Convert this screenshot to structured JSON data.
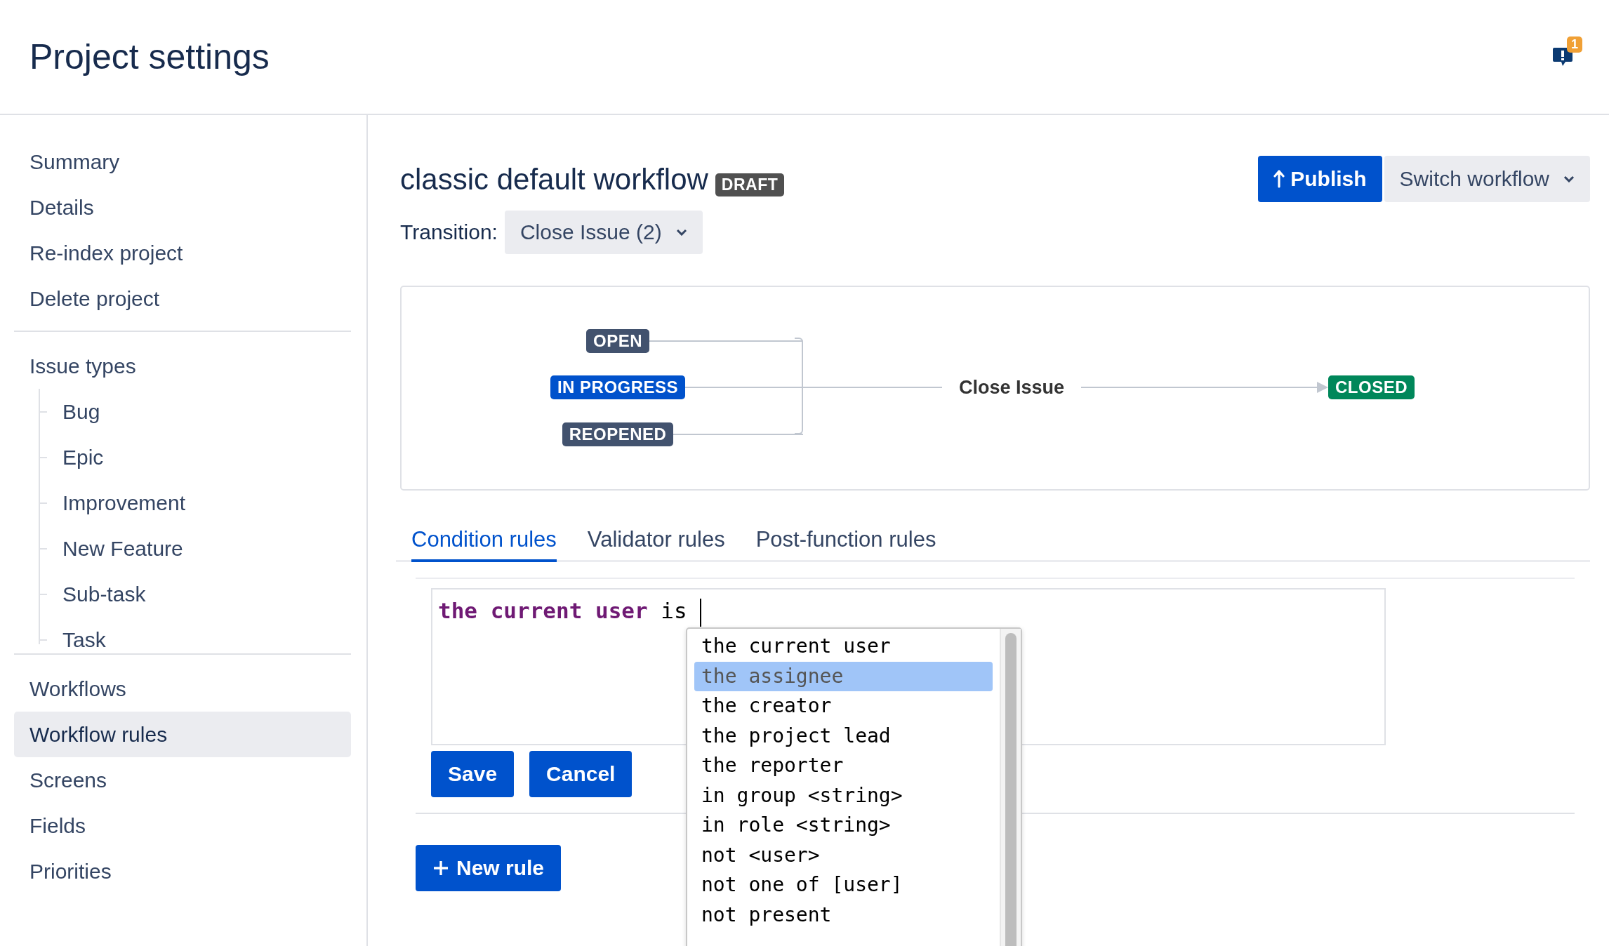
{
  "header": {
    "title": "Project settings",
    "notification_count": "1"
  },
  "sidebar": {
    "groups": [
      {
        "items": [
          {
            "label": "Summary",
            "selected": false
          },
          {
            "label": "Details",
            "selected": false
          },
          {
            "label": "Re-index project",
            "selected": false
          },
          {
            "label": "Delete project",
            "selected": false
          }
        ]
      },
      {
        "items": [
          {
            "label": "Issue types",
            "selected": false,
            "children": [
              {
                "label": "Bug",
                "selected": false
              },
              {
                "label": "Epic",
                "selected": false
              },
              {
                "label": "Improvement",
                "selected": false
              },
              {
                "label": "New Feature",
                "selected": false
              },
              {
                "label": "Sub-task",
                "selected": false
              },
              {
                "label": "Task",
                "selected": false
              }
            ]
          }
        ]
      },
      {
        "items": [
          {
            "label": "Workflows",
            "selected": false
          },
          {
            "label": "Workflow rules",
            "selected": true
          },
          {
            "label": "Screens",
            "selected": false
          },
          {
            "label": "Fields",
            "selected": false
          },
          {
            "label": "Priorities",
            "selected": false
          }
        ]
      }
    ]
  },
  "workflow": {
    "title": "classic default workflow",
    "status_badge": "DRAFT",
    "publish_button": "Publish",
    "switch_button": "Switch workflow",
    "transition_label": "Transition:",
    "transition_value": "Close Issue (2)"
  },
  "diagram": {
    "sources": [
      {
        "label": "OPEN",
        "color": "#42526e"
      },
      {
        "label": "IN PROGRESS",
        "color": "#0052cc"
      },
      {
        "label": "REOPENED",
        "color": "#42526e"
      }
    ],
    "transition": "Close Issue",
    "target": {
      "label": "CLOSED",
      "color": "#00875a"
    }
  },
  "tabs": [
    {
      "label": "Condition rules",
      "selected": true
    },
    {
      "label": "Validator rules",
      "selected": false
    },
    {
      "label": "Post-function rules",
      "selected": false
    }
  ],
  "editor": {
    "segments": [
      {
        "text": "the current user",
        "kind": "keyword"
      },
      {
        "text": "is",
        "kind": "plain"
      }
    ],
    "suggestions": [
      {
        "text": "the current user",
        "selected": false
      },
      {
        "text": "the assignee",
        "selected": true
      },
      {
        "text": "the creator",
        "selected": false
      },
      {
        "text": "the project lead",
        "selected": false
      },
      {
        "text": "the reporter",
        "selected": false
      },
      {
        "text": "in group <string>",
        "selected": false
      },
      {
        "text": "in role <string>",
        "selected": false
      },
      {
        "text": "not <user>",
        "selected": false
      },
      {
        "text": "not one of [user]",
        "selected": false
      },
      {
        "text": "not present",
        "selected": false
      }
    ]
  },
  "actions": {
    "save": "Save",
    "cancel": "Cancel",
    "new_rule": "New rule"
  }
}
